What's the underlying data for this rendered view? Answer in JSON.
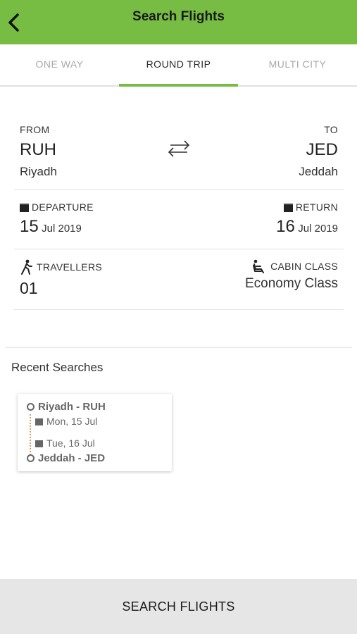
{
  "header": {
    "title": "Search Flights",
    "back_icon": "chevron-left-icon"
  },
  "tabs": [
    {
      "label": "ONE WAY",
      "active": false
    },
    {
      "label": "ROUND TRIP",
      "active": true
    },
    {
      "label": "MULTI CITY",
      "active": false
    }
  ],
  "route": {
    "from_label": "FROM",
    "from_code": "RUH",
    "from_city": "Riyadh",
    "to_label": "TO",
    "to_code": "JED",
    "to_city": "Jeddah",
    "swap_icon": "swap-arrows-icon"
  },
  "dates": {
    "departure_label": "DEPARTURE",
    "departure_day": "15",
    "departure_month_year": "Jul 2019",
    "return_label": "RETURN",
    "return_day": "16",
    "return_month_year": "Jul 2019"
  },
  "passengers": {
    "travellers_label": "TRAVELLERS",
    "travellers_value": "01",
    "cabin_label": "CABIN CLASS",
    "cabin_value": "Economy Class"
  },
  "recent": {
    "title": "Recent Searches",
    "items": [
      {
        "from": "Riyadh - RUH",
        "depart_date": "Mon, 15 Jul",
        "return_date": "Tue, 16 Jul",
        "to": "Jeddah - JED"
      }
    ]
  },
  "actions": {
    "search_label": "SEARCH FLIGHTS"
  },
  "colors": {
    "accent": "#77bd43",
    "route_dots": "#e49a5a",
    "bottom_bar": "#e6e6e6"
  }
}
